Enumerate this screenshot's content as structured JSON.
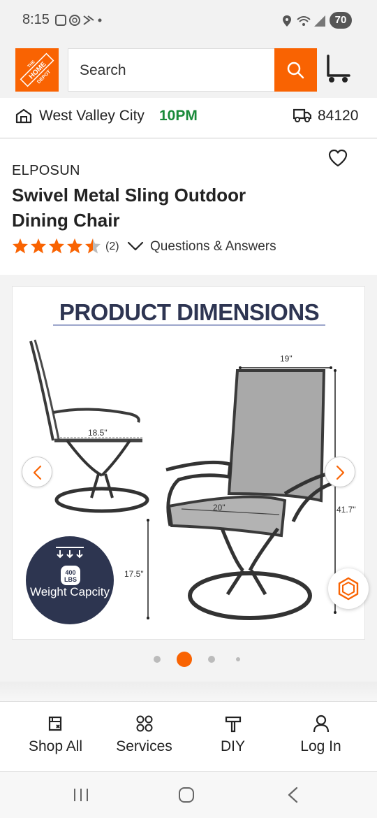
{
  "status_bar": {
    "time": "8:15",
    "battery": "70"
  },
  "header": {
    "logo_text": "THE HOME DEPOT",
    "search_placeholder": "Search",
    "search_icon": "search-icon",
    "cart_icon": "cart-icon",
    "brand_color": "#f96302"
  },
  "location": {
    "store": "West Valley City",
    "hours": "10PM",
    "zip": "84120",
    "hours_color": "#1a8a3a"
  },
  "product": {
    "brand": "ELPOSUN",
    "title": "Swivel Metal Sling Outdoor Dining Chair",
    "rating": 4.5,
    "review_count": "(2)",
    "qa_label": "Questions & Answers"
  },
  "gallery": {
    "image_heading": "PRODUCT DIMENSIONS",
    "dims": {
      "depth": "18.5\"",
      "width": "19\"",
      "seat_width": "20\"",
      "height": "41.7\"",
      "seat_height": "17.5\""
    },
    "badge": {
      "weight": "400 LBS",
      "label": "Weight Capcity"
    },
    "active_slide": 1,
    "slide_count": 4
  },
  "bottom_nav": [
    {
      "label": "Shop All",
      "icon": "shop-all-icon"
    },
    {
      "label": "Services",
      "icon": "services-icon"
    },
    {
      "label": "DIY",
      "icon": "diy-icon"
    },
    {
      "label": "Log In",
      "icon": "user-icon"
    }
  ]
}
